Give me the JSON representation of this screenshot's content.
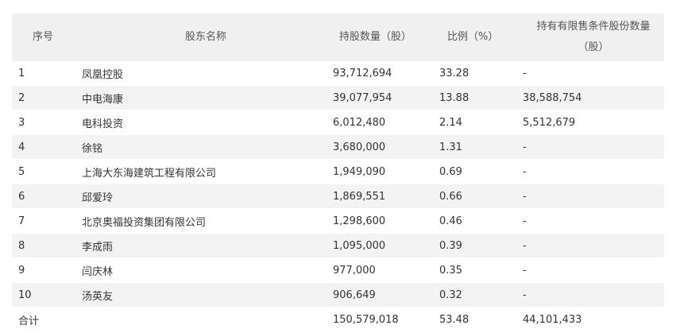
{
  "headers": {
    "index": "序号",
    "name": "股东名称",
    "shares": "持股数量（股）",
    "ratio": "比例（%）",
    "restricted_line1": "持有有限售条件股份数量",
    "restricted_line2": "（股）"
  },
  "rows": [
    {
      "index": "1",
      "name": "凤凰控股",
      "shares": "93,712,694",
      "ratio": "33.28",
      "restricted": "-"
    },
    {
      "index": "2",
      "name": "中电海康",
      "shares": "39,077,954",
      "ratio": "13.88",
      "restricted": "38,588,754"
    },
    {
      "index": "3",
      "name": "电科投资",
      "shares": "6,012,480",
      "ratio": "2.14",
      "restricted": "5,512,679"
    },
    {
      "index": "4",
      "name": "徐铭",
      "shares": "3,680,000",
      "ratio": "1.31",
      "restricted": "-"
    },
    {
      "index": "5",
      "name": "上海大东海建筑工程有限公司",
      "shares": "1,949,090",
      "ratio": "0.69",
      "restricted": "-"
    },
    {
      "index": "6",
      "name": "邱爱玲",
      "shares": "1,869,551",
      "ratio": "0.66",
      "restricted": "-"
    },
    {
      "index": "7",
      "name": "北京奥福投资集团有限公司",
      "shares": "1,298,600",
      "ratio": "0.46",
      "restricted": "-"
    },
    {
      "index": "8",
      "name": "李成雨",
      "shares": "1,095,000",
      "ratio": "0.39",
      "restricted": "-"
    },
    {
      "index": "9",
      "name": "闫庆林",
      "shares": "977,000",
      "ratio": "0.35",
      "restricted": "-"
    },
    {
      "index": "10",
      "name": "汤英友",
      "shares": "906,649",
      "ratio": "0.32",
      "restricted": "-"
    }
  ],
  "total": {
    "label": "合计",
    "shares": "150,579,018",
    "ratio": "53.48",
    "restricted": "44,101,433"
  }
}
